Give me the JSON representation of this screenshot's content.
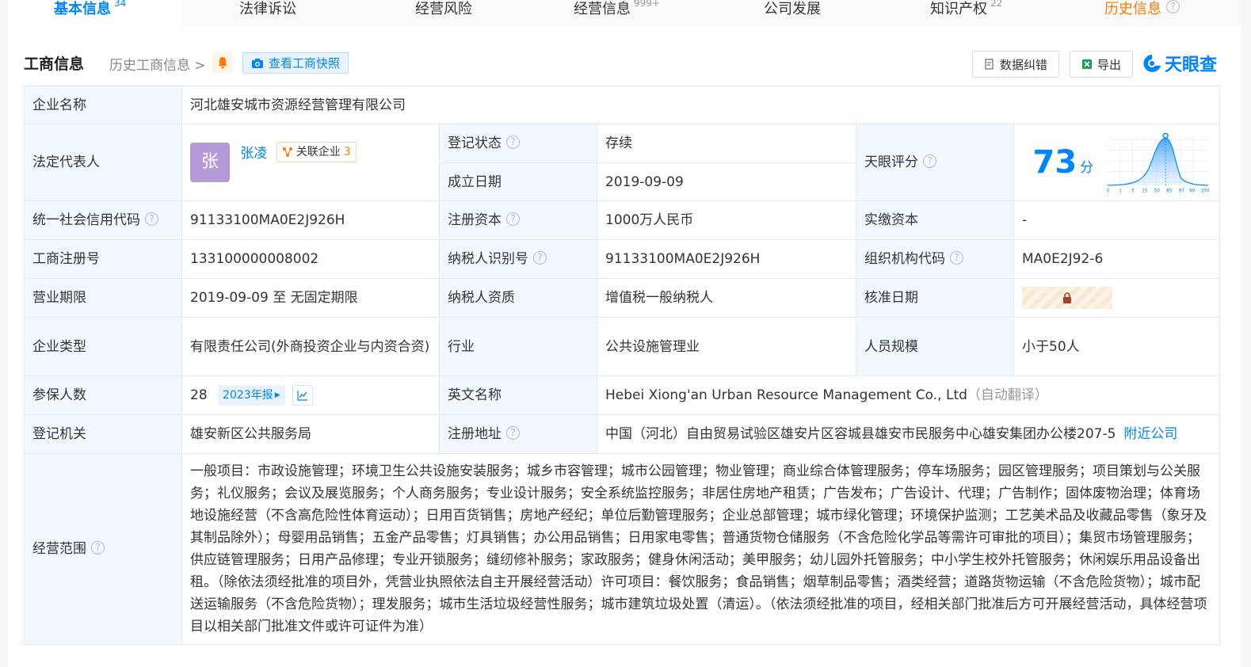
{
  "tabs": [
    {
      "label": "基本信息",
      "count": "34"
    },
    {
      "label": "法律诉讼",
      "count": ""
    },
    {
      "label": "经营风险",
      "count": ""
    },
    {
      "label": "经营信息",
      "count": "999+"
    },
    {
      "label": "公司发展",
      "count": ""
    },
    {
      "label": "知识产权",
      "count": "22"
    },
    {
      "label": "历史信息",
      "count": ""
    }
  ],
  "header": {
    "title": "工商信息",
    "history": "历史工商信息 >",
    "snapshot": "查看工商快照",
    "correct": "数据纠错",
    "export": "导出",
    "logo": "天眼查"
  },
  "rows": {
    "company_name_k": "企业名称",
    "company_name_v": "河北雄安城市资源经营管理有限公司",
    "legal_rep_k": "法定代表人",
    "legal_rep_avatar": "张",
    "legal_rep_name": "张凌",
    "assoc_label": "关联企业",
    "assoc_count": "3",
    "reg_status_k": "登记状态",
    "reg_status_v": "存续",
    "found_date_k": "成立日期",
    "found_date_v": "2019-09-09",
    "score_k": "天眼评分",
    "score_v": "73",
    "score_unit": "分",
    "credit_code_k": "统一社会信用代码",
    "credit_code_v": "91133100MA0E2J926H",
    "reg_capital_k": "注册资本",
    "reg_capital_v": "1000万人民币",
    "paid_capital_k": "实缴资本",
    "paid_capital_v": "-",
    "reg_no_k": "工商注册号",
    "reg_no_v": "133100000008002",
    "tax_id_k": "纳税人识别号",
    "tax_id_v": "91133100MA0E2J926H",
    "org_code_k": "组织机构代码",
    "org_code_v": "MA0E2J92-6",
    "term_k": "营业期限",
    "term_v": "2019-09-09 至 无固定期限",
    "tax_qual_k": "纳税人资质",
    "tax_qual_v": "增值税一般纳税人",
    "approve_k": "核准日期",
    "type_k": "企业类型",
    "type_v": "有限责任公司(外商投资企业与内资合资)",
    "industry_k": "行业",
    "industry_v": "公共设施管理业",
    "staff_k": "人员规模",
    "staff_v": "小于50人",
    "insured_k": "参保人数",
    "insured_v": "28",
    "report_label": "2023年报",
    "en_name_k": "英文名称",
    "en_name_v": "Hebei Xiong'an Urban Resource Management Co., Ltd",
    "en_name_note": "（自动翻译）",
    "authority_k": "登记机关",
    "authority_v": "雄安新区公共服务局",
    "address_k": "注册地址",
    "address_v": "中国（河北）自由贸易试验区雄安片区容城县雄安市民服务中心雄安集团办公楼207-5",
    "nearby": "附近公司",
    "scope_k": "经营范围",
    "scope_v": "一般项目：市政设施管理；环境卫生公共设施安装服务；城乡市容管理；城市公园管理；物业管理；商业综合体管理服务；停车场服务；园区管理服务；项目策划与公关服务；礼仪服务；会议及展览服务；个人商务服务；专业设计服务；安全系统监控服务；非居住房地产租赁；广告发布；广告设计、代理；广告制作；固体废物治理；体育场地设施经营（不含高危险性体育运动）；日用百货销售；房地产经纪；单位后勤管理服务；企业总部管理；城市绿化管理；环境保护监测；工艺美术品及收藏品零售（象牙及其制品除外）；母婴用品销售；五金产品零售；灯具销售；办公用品销售；日用家电零售；普通货物仓储服务（不含危险化学品等需许可审批的项目）；集贸市场管理服务；供应链管理服务；日用产品修理；专业开锁服务；缝纫修补服务；家政服务；健身休闲活动；美甲服务；幼儿园外托管服务；中小学生校外托管服务；休闲娱乐用品设备出租。（除依法须经批准的项目外，凭营业执照依法自主开展经营活动）许可项目：餐饮服务；食品销售；烟草制品零售；酒类经营；道路货物运输（不含危险货物）；城市配送运输服务（不含危险货物）；理发服务；城市生活垃圾经营性服务；城市建筑垃圾处置（清运）。（依法须经批准的项目，经相关部门批准后方可开展经营活动，具体经营项目以相关部门批准文件或许可证件为准）"
  },
  "score_axis": [
    "0",
    "1",
    "3",
    "15",
    "50",
    "85",
    "97",
    "99",
    "100"
  ],
  "colors": {
    "accent": "#0084ff",
    "status": "#00a854",
    "history_tab": "#ff7a00"
  }
}
